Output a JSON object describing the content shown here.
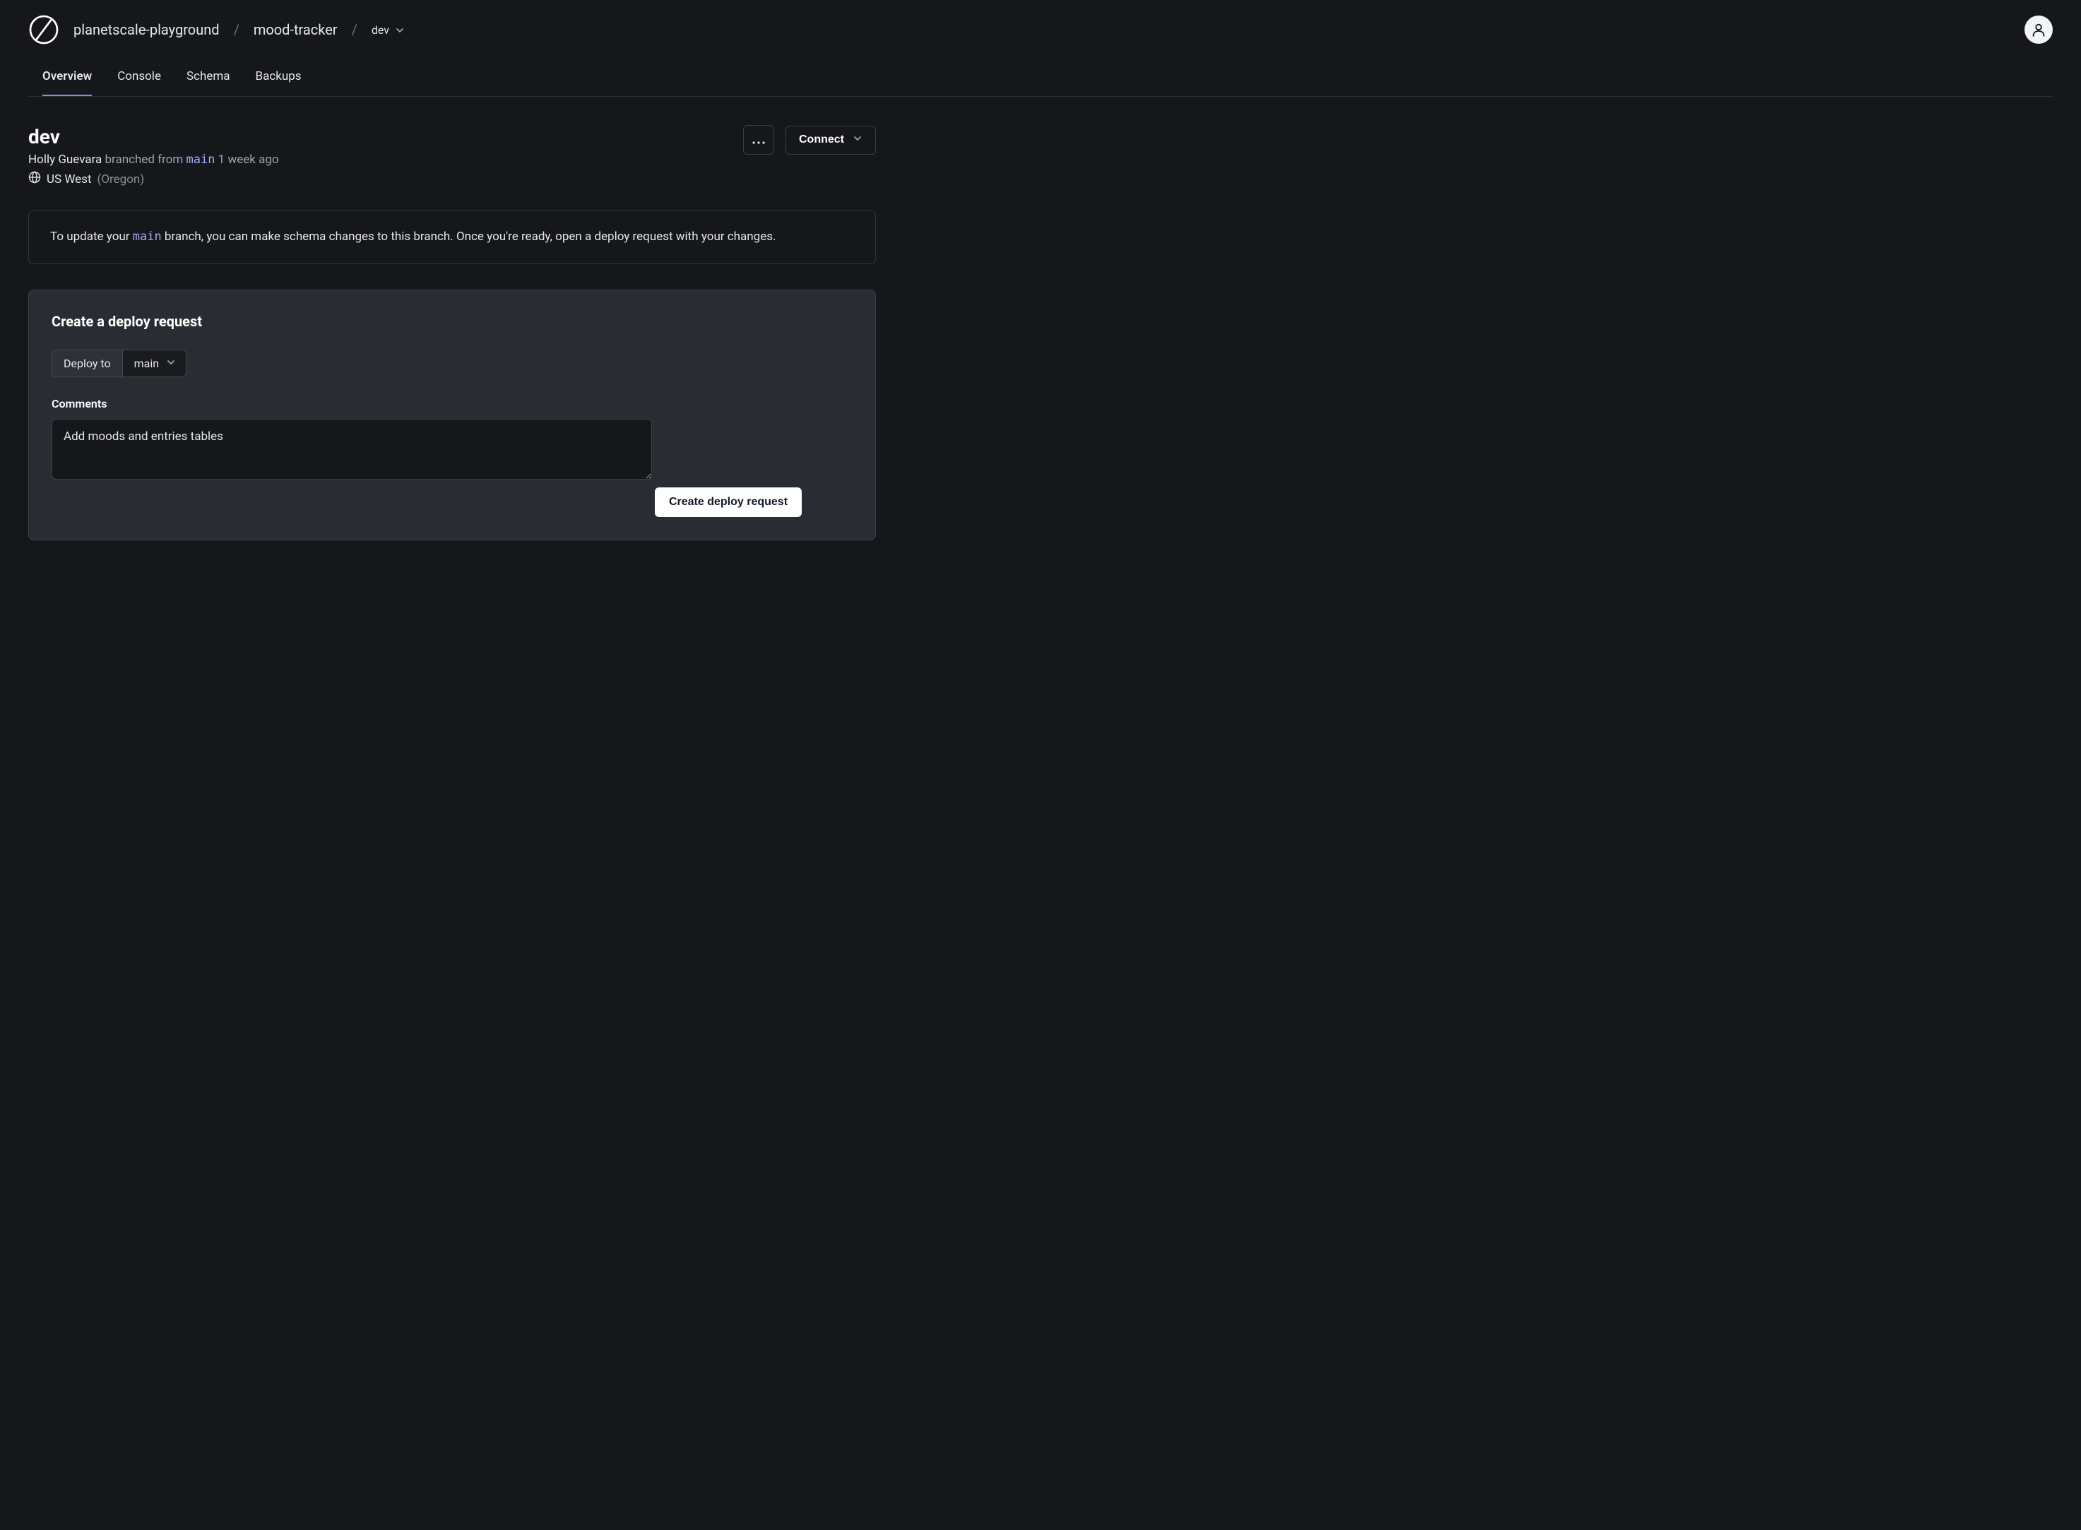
{
  "breadcrumb": {
    "org": "planetscale-playground",
    "database": "mood-tracker",
    "branch": "dev"
  },
  "tabs": [
    {
      "label": "Overview",
      "active": true
    },
    {
      "label": "Console",
      "active": false
    },
    {
      "label": "Schema",
      "active": false
    },
    {
      "label": "Backups",
      "active": false
    }
  ],
  "branch": {
    "name": "dev",
    "author": "Holly Guevara",
    "branched_from_label": "branched from",
    "branched_from_branch": "main",
    "time_ago": "1 week ago",
    "region_name": "US West",
    "region_detail": "(Oregon)"
  },
  "actions": {
    "connect_label": "Connect"
  },
  "info": {
    "text_before": "To update your ",
    "branch": "main",
    "text_after": " branch, you can make schema changes to this branch. Once you're ready, open a deploy request with your changes."
  },
  "deploy_card": {
    "title": "Create a deploy request",
    "deploy_to_label": "Deploy to",
    "deploy_target": "main",
    "comments_label": "Comments",
    "comments_value": "Add moods and entries tables",
    "submit_label": "Create deploy request"
  }
}
